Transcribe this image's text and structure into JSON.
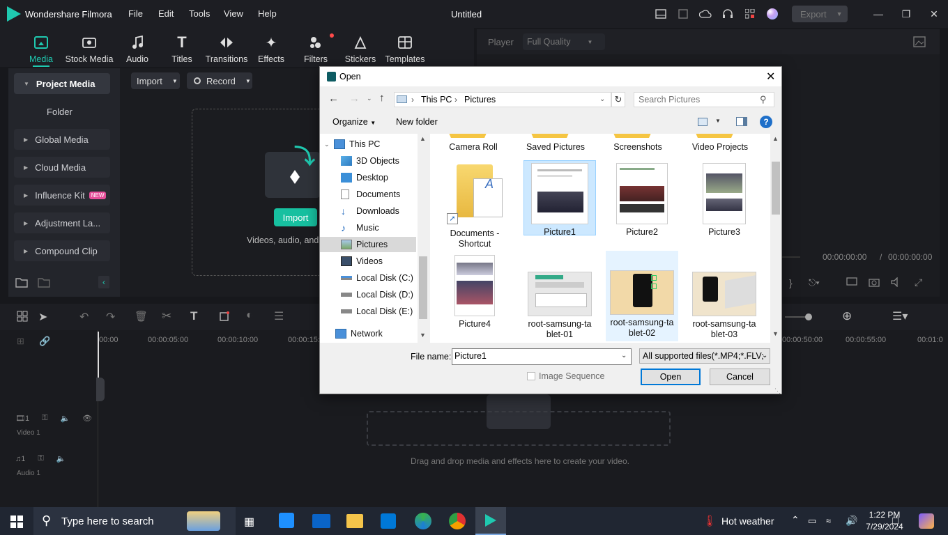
{
  "app": {
    "name": "Wondershare Filmora",
    "project_title": "Untitled",
    "menu": [
      "File",
      "Edit",
      "Tools",
      "View",
      "Help"
    ],
    "export_label": "Export"
  },
  "toolbar": {
    "tabs": [
      {
        "label": "Media",
        "icon": "media-icon"
      },
      {
        "label": "Stock Media",
        "icon": "stock-media-icon"
      },
      {
        "label": "Audio",
        "icon": "music-note-icon"
      },
      {
        "label": "Titles",
        "icon": "title-t-icon"
      },
      {
        "label": "Transitions",
        "icon": "transitions-icon"
      },
      {
        "label": "Effects",
        "icon": "effects-icon"
      },
      {
        "label": "Filters",
        "icon": "filters-icon"
      },
      {
        "label": "Stickers",
        "icon": "stickers-icon"
      },
      {
        "label": "Templates",
        "icon": "templates-icon"
      }
    ]
  },
  "left_panel": {
    "project_media": "Project Media",
    "folder": "Folder",
    "items": [
      "Global Media",
      "Cloud Media",
      "Influence Kit",
      "Adjustment La...",
      "Compound Clip"
    ],
    "new_badge": "NEW"
  },
  "media": {
    "import_dropdown": "Import",
    "record_dropdown": "Record",
    "import_button": "Import",
    "hint": "Videos, audio, and i"
  },
  "player": {
    "label": "Player",
    "quality": "Full Quality",
    "time_current": "00:00:00:00",
    "time_sep": "/",
    "time_total": "00:00:00:00"
  },
  "timeline": {
    "ruler": [
      "00:00",
      "00:00:05:00",
      "00:00:10:00",
      "00:00:15:",
      "00:00:50:00",
      "00:00:55:00",
      "00:01:0"
    ],
    "video_track": "Video 1",
    "audio_track": "Audio 1",
    "track_num": "1",
    "drop_hint": "Drag and drop media and effects here to create your video."
  },
  "dialog": {
    "title": "Open",
    "path": [
      "This PC",
      "Pictures"
    ],
    "search_placeholder": "Search Pictures",
    "organize": "Organize",
    "new_folder": "New folder",
    "nav": [
      {
        "label": "This PC",
        "icon": "computer-icon"
      },
      {
        "label": "3D Objects",
        "icon": "3d-objects-icon"
      },
      {
        "label": "Desktop",
        "icon": "desktop-icon"
      },
      {
        "label": "Documents",
        "icon": "documents-icon"
      },
      {
        "label": "Downloads",
        "icon": "downloads-icon"
      },
      {
        "label": "Music",
        "icon": "music-icon"
      },
      {
        "label": "Pictures",
        "icon": "pictures-icon"
      },
      {
        "label": "Videos",
        "icon": "videos-icon"
      },
      {
        "label": "Local Disk (C:)",
        "icon": "drive-icon"
      },
      {
        "label": "Local Disk (D:)",
        "icon": "drive-icon"
      },
      {
        "label": "Local Disk (E:)",
        "icon": "drive-icon"
      },
      {
        "label": "Network",
        "icon": "network-icon"
      }
    ],
    "top_folders": [
      "Camera Roll",
      "Saved Pictures",
      "Screenshots",
      "Video Projects"
    ],
    "files_row1": [
      {
        "name": "Documents - Shortcut"
      },
      {
        "name": "Picture1"
      },
      {
        "name": "Picture2"
      },
      {
        "name": "Picture3"
      }
    ],
    "files_row2": [
      {
        "name": "Picture4"
      },
      {
        "name": "root-samsung-ta blet-01"
      },
      {
        "name": "root-samsung-ta blet-02"
      },
      {
        "name": "root-samsung-ta blet-03"
      }
    ],
    "file_name_label": "File name:",
    "file_name_value": "Picture1",
    "filter": "All supported files(*.MP4;*.FLV;",
    "image_sequence": "Image Sequence",
    "open": "Open",
    "cancel": "Cancel"
  },
  "taskbar": {
    "search_placeholder": "Type here to search",
    "weather": "Hot weather",
    "time": "1:22 PM",
    "date": "7/29/2024"
  },
  "colors": {
    "accent": "#1fc9b0",
    "selection": "#cce8ff",
    "app_bg": "#17181c"
  }
}
